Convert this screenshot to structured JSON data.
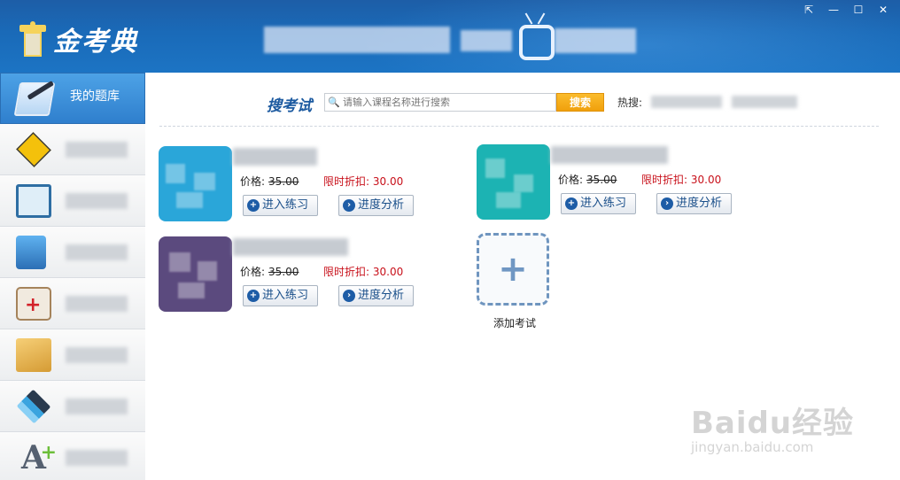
{
  "app": {
    "logo_text": "金考典"
  },
  "window_controls": {
    "pin": "⇱",
    "minimize": "—",
    "maximize": "☐",
    "close": "✕"
  },
  "sidebar": {
    "active_label": "我的题库",
    "items": [
      {
        "icon": "book-pen-icon"
      },
      {
        "icon": "construction-sign-icon"
      },
      {
        "icon": "clipboard-icon"
      },
      {
        "icon": "bar-chart-book-icon"
      },
      {
        "icon": "medical-kit-icon"
      },
      {
        "icon": "folder-icon"
      },
      {
        "icon": "layers-icon"
      },
      {
        "icon": "letter-a-plus-icon"
      }
    ]
  },
  "search": {
    "title": "搜考试",
    "placeholder": "请输入课程名称进行搜索",
    "button_label": "搜索",
    "hot_label": "热搜:"
  },
  "courses": [
    {
      "price_label": "价格:",
      "original_price": "35.00",
      "discount_label": "限时折扣:",
      "discount_price": "30.00",
      "practice_label": "进入练习",
      "analysis_label": "进度分析",
      "thumb_color": "#2aa6d9"
    },
    {
      "price_label": "价格:",
      "original_price": "35.00",
      "discount_label": "限时折扣:",
      "discount_price": "30.00",
      "practice_label": "进入练习",
      "analysis_label": "进度分析",
      "thumb_color": "#1cb3b3"
    },
    {
      "price_label": "价格:",
      "original_price": "35.00",
      "discount_label": "限时折扣:",
      "discount_price": "30.00",
      "practice_label": "进入练习",
      "analysis_label": "进度分析",
      "thumb_color": "#5b4a7e"
    }
  ],
  "add_exam": {
    "plus": "+",
    "label": "添加考试"
  },
  "watermark": {
    "main": "Baidu经验",
    "sub": "jingyan.baidu.com"
  },
  "colors": {
    "header_blue": "#1a6ab8",
    "accent_orange": "#f0a00c",
    "discount_red": "#c8101a"
  }
}
